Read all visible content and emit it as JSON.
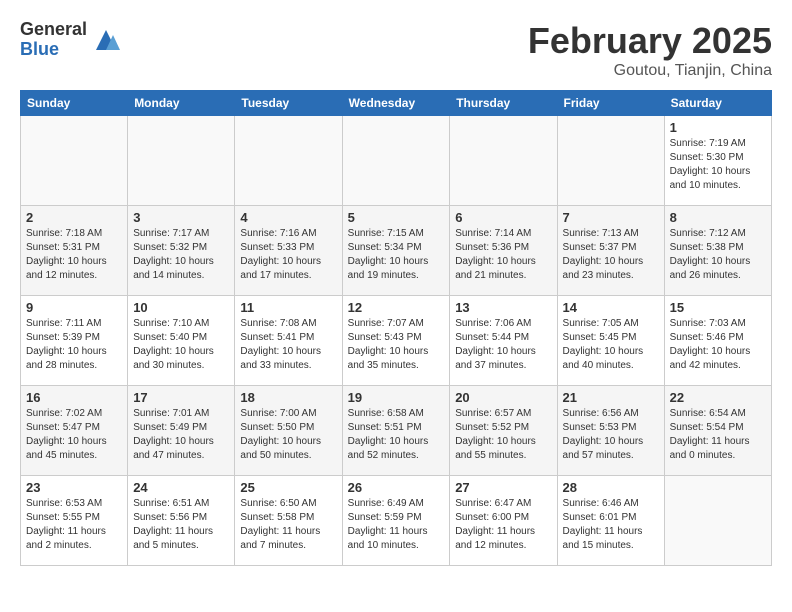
{
  "header": {
    "logo_general": "General",
    "logo_blue": "Blue",
    "month_title": "February 2025",
    "location": "Goutou, Tianjin, China"
  },
  "weekdays": [
    "Sunday",
    "Monday",
    "Tuesday",
    "Wednesday",
    "Thursday",
    "Friday",
    "Saturday"
  ],
  "weeks": [
    [
      {
        "day": "",
        "info": ""
      },
      {
        "day": "",
        "info": ""
      },
      {
        "day": "",
        "info": ""
      },
      {
        "day": "",
        "info": ""
      },
      {
        "day": "",
        "info": ""
      },
      {
        "day": "",
        "info": ""
      },
      {
        "day": "1",
        "info": "Sunrise: 7:19 AM\nSunset: 5:30 PM\nDaylight: 10 hours\nand 10 minutes."
      }
    ],
    [
      {
        "day": "2",
        "info": "Sunrise: 7:18 AM\nSunset: 5:31 PM\nDaylight: 10 hours\nand 12 minutes."
      },
      {
        "day": "3",
        "info": "Sunrise: 7:17 AM\nSunset: 5:32 PM\nDaylight: 10 hours\nand 14 minutes."
      },
      {
        "day": "4",
        "info": "Sunrise: 7:16 AM\nSunset: 5:33 PM\nDaylight: 10 hours\nand 17 minutes."
      },
      {
        "day": "5",
        "info": "Sunrise: 7:15 AM\nSunset: 5:34 PM\nDaylight: 10 hours\nand 19 minutes."
      },
      {
        "day": "6",
        "info": "Sunrise: 7:14 AM\nSunset: 5:36 PM\nDaylight: 10 hours\nand 21 minutes."
      },
      {
        "day": "7",
        "info": "Sunrise: 7:13 AM\nSunset: 5:37 PM\nDaylight: 10 hours\nand 23 minutes."
      },
      {
        "day": "8",
        "info": "Sunrise: 7:12 AM\nSunset: 5:38 PM\nDaylight: 10 hours\nand 26 minutes."
      }
    ],
    [
      {
        "day": "9",
        "info": "Sunrise: 7:11 AM\nSunset: 5:39 PM\nDaylight: 10 hours\nand 28 minutes."
      },
      {
        "day": "10",
        "info": "Sunrise: 7:10 AM\nSunset: 5:40 PM\nDaylight: 10 hours\nand 30 minutes."
      },
      {
        "day": "11",
        "info": "Sunrise: 7:08 AM\nSunset: 5:41 PM\nDaylight: 10 hours\nand 33 minutes."
      },
      {
        "day": "12",
        "info": "Sunrise: 7:07 AM\nSunset: 5:43 PM\nDaylight: 10 hours\nand 35 minutes."
      },
      {
        "day": "13",
        "info": "Sunrise: 7:06 AM\nSunset: 5:44 PM\nDaylight: 10 hours\nand 37 minutes."
      },
      {
        "day": "14",
        "info": "Sunrise: 7:05 AM\nSunset: 5:45 PM\nDaylight: 10 hours\nand 40 minutes."
      },
      {
        "day": "15",
        "info": "Sunrise: 7:03 AM\nSunset: 5:46 PM\nDaylight: 10 hours\nand 42 minutes."
      }
    ],
    [
      {
        "day": "16",
        "info": "Sunrise: 7:02 AM\nSunset: 5:47 PM\nDaylight: 10 hours\nand 45 minutes."
      },
      {
        "day": "17",
        "info": "Sunrise: 7:01 AM\nSunset: 5:49 PM\nDaylight: 10 hours\nand 47 minutes."
      },
      {
        "day": "18",
        "info": "Sunrise: 7:00 AM\nSunset: 5:50 PM\nDaylight: 10 hours\nand 50 minutes."
      },
      {
        "day": "19",
        "info": "Sunrise: 6:58 AM\nSunset: 5:51 PM\nDaylight: 10 hours\nand 52 minutes."
      },
      {
        "day": "20",
        "info": "Sunrise: 6:57 AM\nSunset: 5:52 PM\nDaylight: 10 hours\nand 55 minutes."
      },
      {
        "day": "21",
        "info": "Sunrise: 6:56 AM\nSunset: 5:53 PM\nDaylight: 10 hours\nand 57 minutes."
      },
      {
        "day": "22",
        "info": "Sunrise: 6:54 AM\nSunset: 5:54 PM\nDaylight: 11 hours\nand 0 minutes."
      }
    ],
    [
      {
        "day": "23",
        "info": "Sunrise: 6:53 AM\nSunset: 5:55 PM\nDaylight: 11 hours\nand 2 minutes."
      },
      {
        "day": "24",
        "info": "Sunrise: 6:51 AM\nSunset: 5:56 PM\nDaylight: 11 hours\nand 5 minutes."
      },
      {
        "day": "25",
        "info": "Sunrise: 6:50 AM\nSunset: 5:58 PM\nDaylight: 11 hours\nand 7 minutes."
      },
      {
        "day": "26",
        "info": "Sunrise: 6:49 AM\nSunset: 5:59 PM\nDaylight: 11 hours\nand 10 minutes."
      },
      {
        "day": "27",
        "info": "Sunrise: 6:47 AM\nSunset: 6:00 PM\nDaylight: 11 hours\nand 12 minutes."
      },
      {
        "day": "28",
        "info": "Sunrise: 6:46 AM\nSunset: 6:01 PM\nDaylight: 11 hours\nand 15 minutes."
      },
      {
        "day": "",
        "info": ""
      }
    ]
  ]
}
